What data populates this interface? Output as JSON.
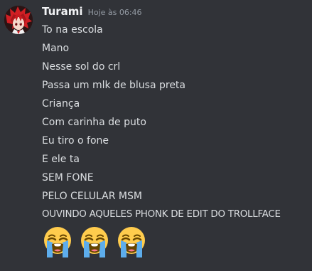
{
  "message": {
    "username": "Turami",
    "timestamp": "Hoje às 06:46",
    "lines": [
      "To na escola",
      "Mano",
      "Nesse sol do crl",
      "Passa um mlk de blusa preta",
      "Criança",
      "Com carinha de puto",
      "Eu tiro o fone",
      "E ele ta",
      "SEM FONE",
      "PELO CELULAR MSM",
      "OUVINDO AQUELES PHONK DE EDIT DO TROLLFACE"
    ],
    "emojis": [
      "loudly-crying-face-icon",
      "loudly-crying-face-icon",
      "loudly-crying-face-icon"
    ]
  },
  "colors": {
    "background": "#313338",
    "username": "#f2f3f5",
    "text": "#dbdee1",
    "timestamp": "#949ba4"
  }
}
